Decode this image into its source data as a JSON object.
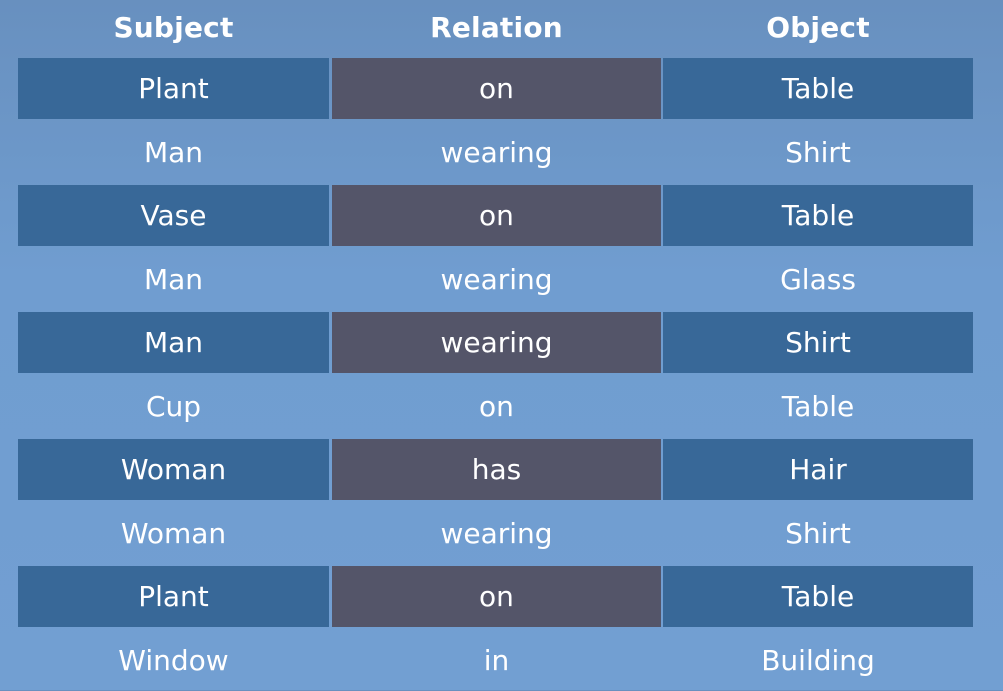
{
  "header": {
    "subject": "Subject",
    "relation": "Relation",
    "object": "Object"
  },
  "rows": [
    {
      "subject": "Plant",
      "relation": "on",
      "object": "Table"
    },
    {
      "subject": "Man",
      "relation": "wearing",
      "object": "Shirt"
    },
    {
      "subject": "Vase",
      "relation": "on",
      "object": "Table"
    },
    {
      "subject": "Man",
      "relation": "wearing",
      "object": "Glass"
    },
    {
      "subject": "Man",
      "relation": "wearing",
      "object": "Shirt"
    },
    {
      "subject": "Cup",
      "relation": "on",
      "object": "Table"
    },
    {
      "subject": "Woman",
      "relation": "has",
      "object": "Hair"
    },
    {
      "subject": "Woman",
      "relation": "wearing",
      "object": "Shirt"
    },
    {
      "subject": "Plant",
      "relation": "on",
      "object": "Table"
    },
    {
      "subject": "Window",
      "relation": "in",
      "object": "Building"
    }
  ],
  "colors": {
    "background": "#709dd0",
    "shaded_cell": "#386898",
    "shaded_relation_cell": "#545569",
    "text": "#ffffff"
  }
}
